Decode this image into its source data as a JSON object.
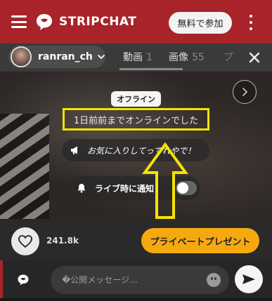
{
  "header": {
    "brand": "STRIPCHAT",
    "join_label": "無料で参加",
    "brand_color": "#a8232a"
  },
  "tabs": {
    "username": "ranran_ch",
    "items": [
      {
        "label": "動画",
        "count": "1"
      },
      {
        "label": "画像",
        "count": "55"
      },
      {
        "label": "プ"
      }
    ]
  },
  "player": {
    "offline_badge": "オフライン",
    "offline_message": "1日前前までオンラインでした",
    "favorite_prompt": "お気に入りしてってれやで！",
    "notify_label": "ライブ時に通知",
    "notify_enabled": false,
    "annotation_color": "#f4e400"
  },
  "actions": {
    "like_count": "241.8k",
    "private_label": "プライベートプレゼント",
    "private_color": "#f6a90f"
  },
  "chat": {
    "placeholder": "�公開メッセージ..."
  },
  "icons": {
    "menu": "hamburger-icon",
    "logo": "stripchat-logo-icon",
    "more": "kebab-icon",
    "dropdown": "chevron-down-icon",
    "close": "close-icon",
    "next": "chevron-right-icon",
    "megaphone": "megaphone-icon",
    "bell": "bell-icon",
    "heart": "heart-icon",
    "chat": "chat-bubble-icon",
    "emoji": "emoji-icon",
    "send": "send-icon"
  }
}
